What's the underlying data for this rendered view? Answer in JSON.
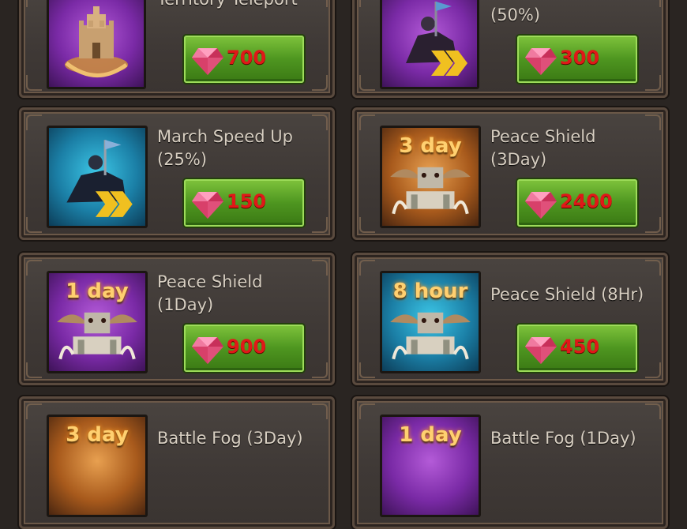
{
  "store_items": [
    {
      "title": "Territory Teleport",
      "price": "700",
      "icon": "castle-teleport-icon",
      "bg": "purple",
      "badge": ""
    },
    {
      "title": "(50%)",
      "price": "300",
      "icon": "march-speed-icon",
      "bg": "purple",
      "badge": ""
    },
    {
      "title": "March Speed Up\n(25%)",
      "price": "150",
      "icon": "march-speed-icon",
      "bg": "teal",
      "badge": ""
    },
    {
      "title": "Peace Shield\n(3Day)",
      "price": "2400",
      "icon": "peace-shield-icon",
      "bg": "orange",
      "badge": "3 day"
    },
    {
      "title": "Peace Shield\n(1Day)",
      "price": "900",
      "icon": "peace-shield-icon",
      "bg": "purple",
      "badge": "1 day"
    },
    {
      "title": "Peace Shield (8Hr)",
      "price": "450",
      "icon": "peace-shield-icon",
      "bg": "teal",
      "badge": "8 hour"
    },
    {
      "title": "Battle Fog (3Day)",
      "price": "",
      "icon": "battle-fog-icon",
      "bg": "orange",
      "badge": "3 day"
    },
    {
      "title": "Battle Fog (1Day)",
      "price": "",
      "icon": "battle-fog-icon",
      "bg": "purple",
      "badge": "1 day"
    }
  ],
  "colors": {
    "price_text": "#e01818",
    "buy_button": "#4e9620",
    "gem": "#e0507a"
  }
}
